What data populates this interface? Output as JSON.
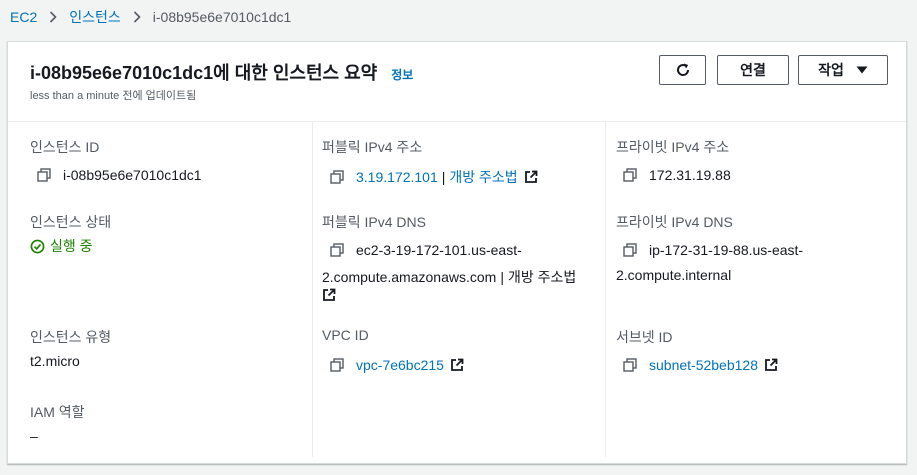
{
  "breadcrumb": {
    "items": [
      "EC2",
      "인스턴스",
      "i-08b95e6e7010c1dc1"
    ]
  },
  "header": {
    "title": "i-08b95e6e7010c1dc1에 대한 인스턴스 요약",
    "info_link": "정보",
    "subtitle": "less than a minute 전에 업데이트됨",
    "connect_label": "연결",
    "action_label": "작업"
  },
  "details": {
    "instance_id": {
      "label": "인스턴스 ID",
      "value": "i-08b95e6e7010c1dc1"
    },
    "public_ipv4": {
      "label": "퍼블릭 IPv4 주소",
      "value": "3.19.172.101",
      "open_link": "개방 주소법"
    },
    "private_ipv4": {
      "label": "프라이빗 IPv4 주소",
      "value": "172.31.19.88"
    },
    "instance_state": {
      "label": "인스턴스 상태",
      "value": "실행 중"
    },
    "public_dns": {
      "label": "퍼블릭 IPv4 DNS",
      "value_line1": "ec2-3-19-172-101.us-east-",
      "value_line2": "2.compute.amazonaws.com",
      "open_link": "개방 주소법"
    },
    "private_dns": {
      "label": "프라이빗 IPv4 DNS",
      "value_line1": "ip-172-31-19-88.us-east-",
      "value_line2": "2.compute.internal"
    },
    "instance_type": {
      "label": "인스턴스 유형",
      "value": "t2.micro"
    },
    "vpc_id": {
      "label": "VPC ID",
      "value": "vpc-7e6bc215"
    },
    "subnet_id": {
      "label": "서브넷 ID",
      "value": "subnet-52beb128"
    },
    "iam_role": {
      "label": "IAM 역할",
      "value": "–"
    }
  },
  "colors": {
    "link": "#0073bb",
    "running": "#1d8102",
    "muted": "#545b64",
    "background": "#f2f3f3"
  },
  "icons": [
    "chevron-right-icon",
    "refresh-icon",
    "caret-down-icon",
    "copy-icon",
    "external-link-icon",
    "check-circle-icon"
  ]
}
